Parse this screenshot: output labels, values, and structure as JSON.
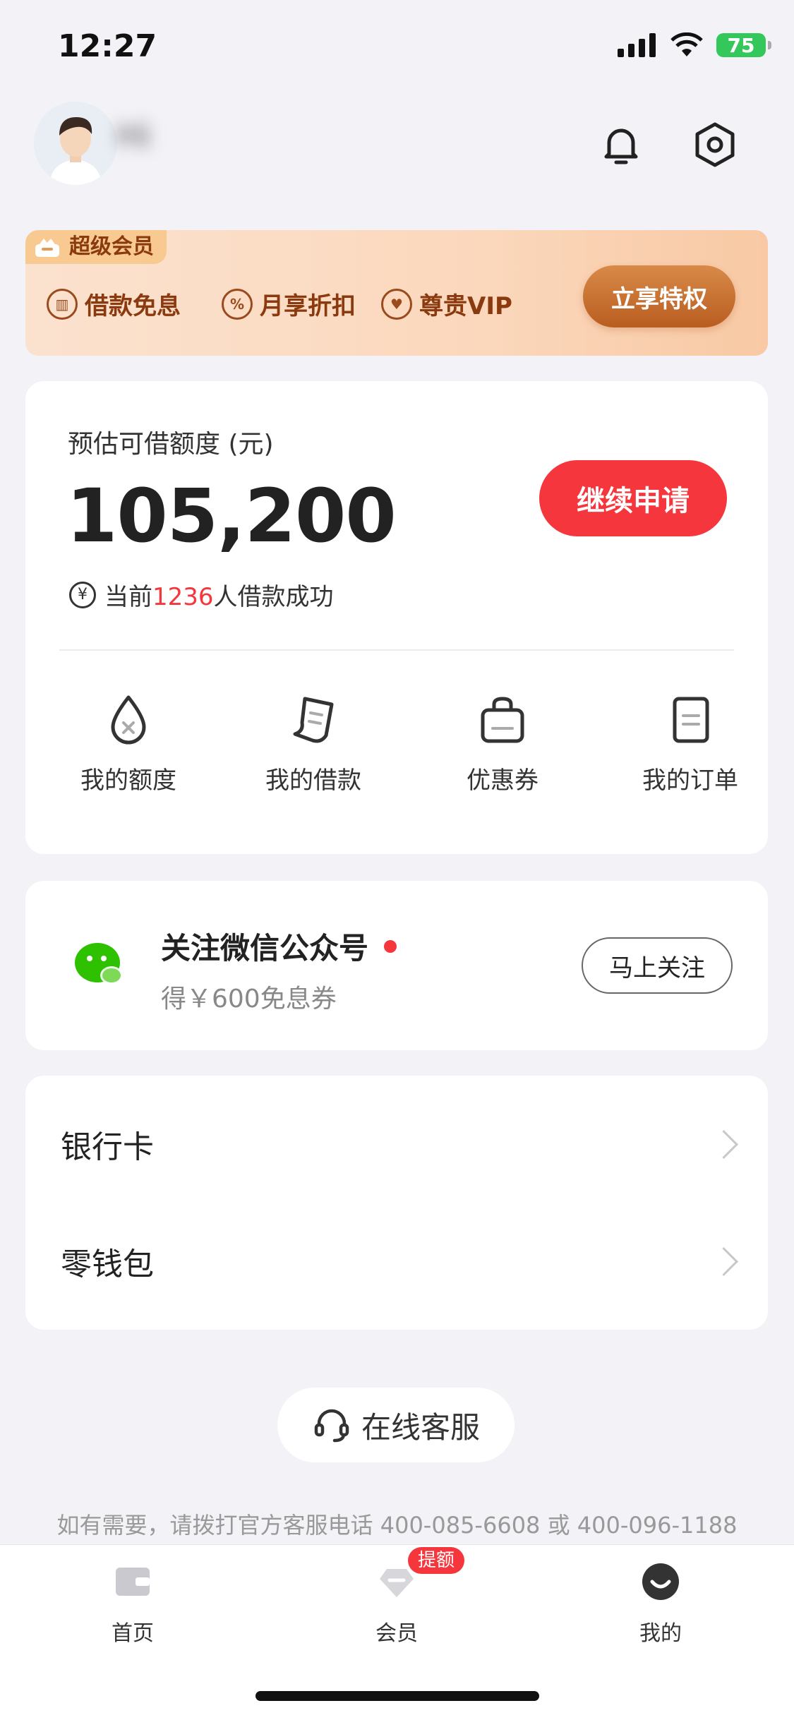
{
  "status_bar": {
    "time": "12:27",
    "battery": "75"
  },
  "header": {
    "greeting": "Hi"
  },
  "vip": {
    "tag": "超级会员",
    "perks": [
      {
        "icon": "loan-icon",
        "label": "借款免息"
      },
      {
        "icon": "discount-icon",
        "label": "月享折扣"
      },
      {
        "icon": "vip-heart-icon",
        "label": "尊贵VIP"
      }
    ],
    "cta": "立享特权"
  },
  "credit": {
    "label": "预估可借额度 (元)",
    "amount": "105,200",
    "apply_button": "继续申请",
    "success_prefix": "当前",
    "success_count": "1236",
    "success_suffix": "人借款成功",
    "quick_links": [
      {
        "icon": "credit-drop-icon",
        "label": "我的额度"
      },
      {
        "icon": "loan-note-icon",
        "label": "我的借款"
      },
      {
        "icon": "coupon-bag-icon",
        "label": "优惠券"
      },
      {
        "icon": "order-doc-icon",
        "label": "我的订单"
      }
    ]
  },
  "wechat": {
    "title": "关注微信公众号",
    "subtitle": "得￥600免息券",
    "button": "马上关注"
  },
  "list": [
    {
      "label": "银行卡"
    },
    {
      "label": "零钱包"
    }
  ],
  "service": {
    "button": "在线客服",
    "hotline": "如有需要，请拨打官方客服电话 400-085-6608 或 400-096-1188"
  },
  "tabbar": {
    "items": [
      {
        "icon": "home-wallet-icon",
        "label": "首页"
      },
      {
        "icon": "member-diamond-icon",
        "label": "会员"
      },
      {
        "icon": "profile-face-icon",
        "label": "我的"
      }
    ],
    "badge": "提额"
  }
}
